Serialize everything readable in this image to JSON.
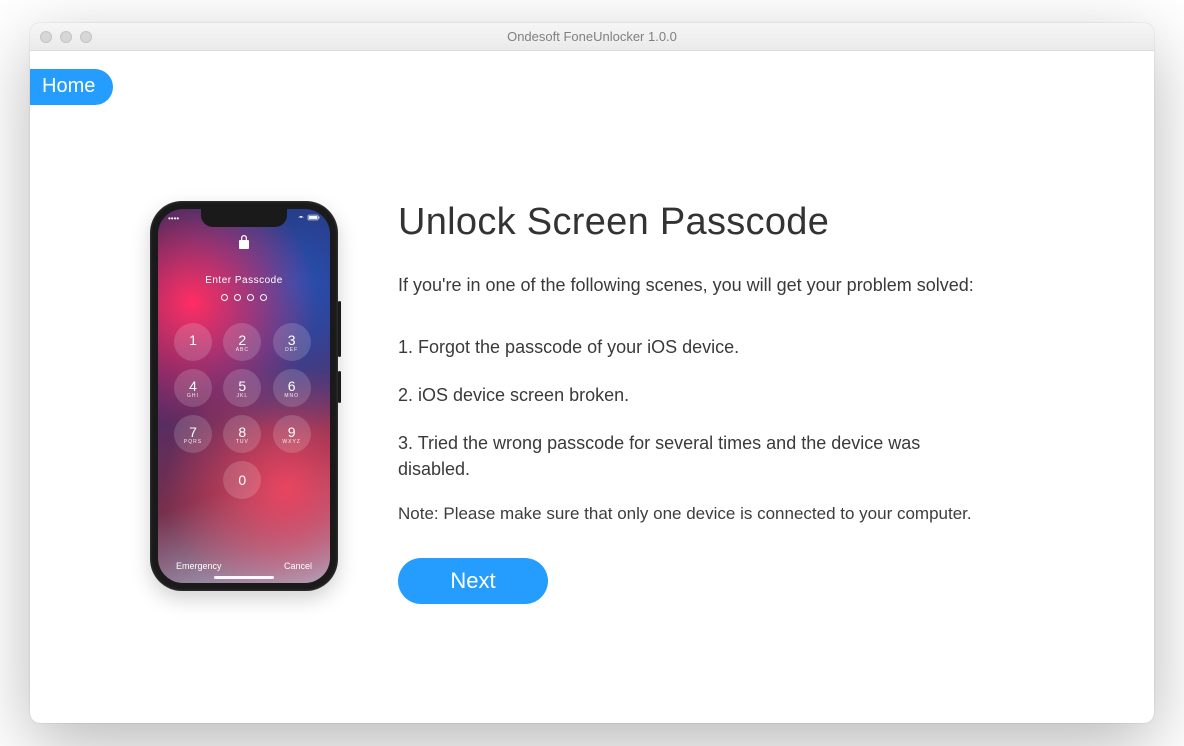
{
  "window": {
    "title": "Ondesoft FoneUnlocker 1.0.0"
  },
  "nav": {
    "home_label": "Home"
  },
  "main": {
    "heading": "Unlock Screen Passcode",
    "intro": "If you're in one of the following scenes, you will get your problem solved:",
    "item1": "1. Forgot the passcode of your iOS device.",
    "item2": "2. iOS device screen broken.",
    "item3": "3. Tried the wrong passcode for several times and the device was disabled.",
    "note": "Note: Please make sure that only one device is connected to your computer.",
    "next_label": "Next"
  },
  "phone": {
    "enter_passcode": "Enter Passcode",
    "emergency": "Emergency",
    "cancel": "Cancel",
    "keys": {
      "k1": "1",
      "k2": "2",
      "k2s": "ABC",
      "k3": "3",
      "k3s": "DEF",
      "k4": "4",
      "k4s": "GHI",
      "k5": "5",
      "k5s": "JKL",
      "k6": "6",
      "k6s": "MNO",
      "k7": "7",
      "k7s": "PQRS",
      "k8": "8",
      "k8s": "TUV",
      "k9": "9",
      "k9s": "WXYZ",
      "k0": "0"
    }
  }
}
